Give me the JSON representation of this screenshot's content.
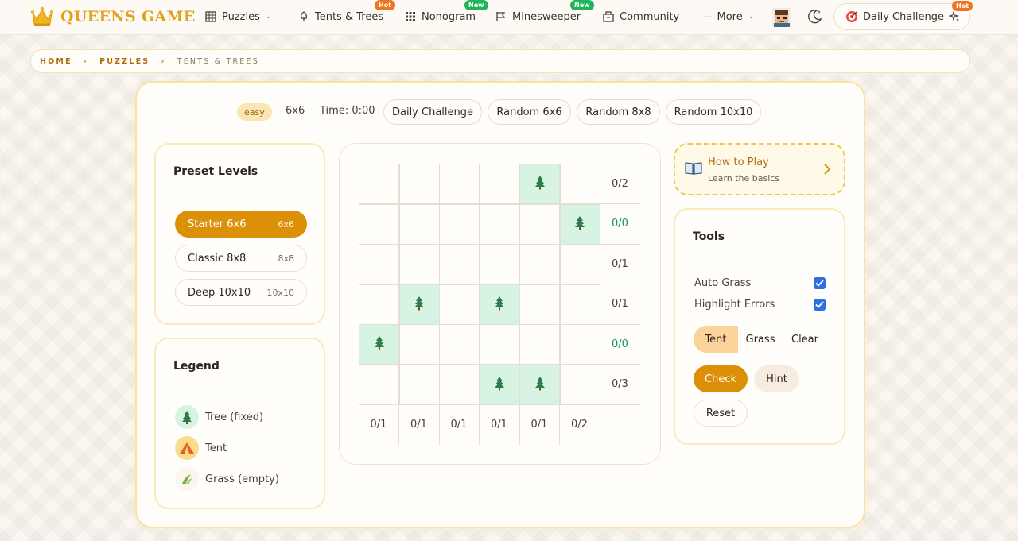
{
  "brand": {
    "name": "QUEENS GAME"
  },
  "nav": {
    "items": [
      {
        "label": "Puzzles",
        "icon": "grid-icon",
        "caret": "⌄"
      },
      {
        "label": "Tents & Trees",
        "icon": "tree-outline-icon",
        "badge": "Hot"
      },
      {
        "label": "Nonogram",
        "icon": "dots-grid-icon",
        "badge": "New"
      },
      {
        "label": "Minesweeper",
        "icon": "flag-icon",
        "badge": "New"
      },
      {
        "label": "Community",
        "icon": "community-icon"
      },
      {
        "label": "More",
        "icon": "ellipsis-icon",
        "caret": "⌄"
      }
    ],
    "daily_challenge": {
      "label": "Daily Challenge",
      "badge": "Hot"
    }
  },
  "breadcrumb": [
    "HOME",
    "PUZZLES",
    "TENTS & TREES"
  ],
  "controls": {
    "difficulty": "easy",
    "size": "6x6",
    "time": "Time: 0:00",
    "buttons": [
      "Daily Challenge",
      "Random 6x6",
      "Random 8x8",
      "Random 10x10"
    ]
  },
  "preset": {
    "title": "Preset Levels",
    "levels": [
      {
        "name": "Starter 6x6",
        "size": "6x6",
        "active": true
      },
      {
        "name": "Classic 8x8",
        "size": "8x8",
        "active": false
      },
      {
        "name": "Deep 10x10",
        "size": "10x10",
        "active": false
      }
    ]
  },
  "legend": {
    "title": "Legend",
    "items": [
      {
        "label": "Tree (fixed)",
        "icon": "tree-icon",
        "color": "#d7f4e3"
      },
      {
        "label": "Tent",
        "icon": "tent-icon",
        "color": "#fbdc8a"
      },
      {
        "label": "Grass (empty)",
        "icon": "grass-icon",
        "color": "#fbf6ec"
      }
    ]
  },
  "board": {
    "rows": 6,
    "cols": 6,
    "trees": [
      [
        0,
        4
      ],
      [
        1,
        5
      ],
      [
        3,
        1
      ],
      [
        3,
        3
      ],
      [
        4,
        0
      ],
      [
        5,
        3
      ],
      [
        5,
        4
      ]
    ],
    "row_clues": [
      {
        "text": "0/2",
        "done": false
      },
      {
        "text": "0/0",
        "done": true
      },
      {
        "text": "0/1",
        "done": false
      },
      {
        "text": "0/1",
        "done": false
      },
      {
        "text": "0/0",
        "done": true
      },
      {
        "text": "0/3",
        "done": false
      }
    ],
    "col_clues": [
      "0/1",
      "0/1",
      "0/1",
      "0/1",
      "0/1",
      "0/2"
    ]
  },
  "howto": {
    "title": "How to Play",
    "subtitle": "Learn the basics"
  },
  "tools": {
    "title": "Tools",
    "auto_grass": "Auto Grass",
    "highlight_errors": "Highlight Errors",
    "modes": [
      "Tent",
      "Grass",
      "Clear"
    ],
    "check": "Check",
    "hint": "Hint",
    "reset": "Reset"
  },
  "colors": {
    "accent": "#dc9008",
    "tree_cell": "#d7f4e3",
    "clue_done": "#129558",
    "checkbox": "#2f6fe0"
  }
}
